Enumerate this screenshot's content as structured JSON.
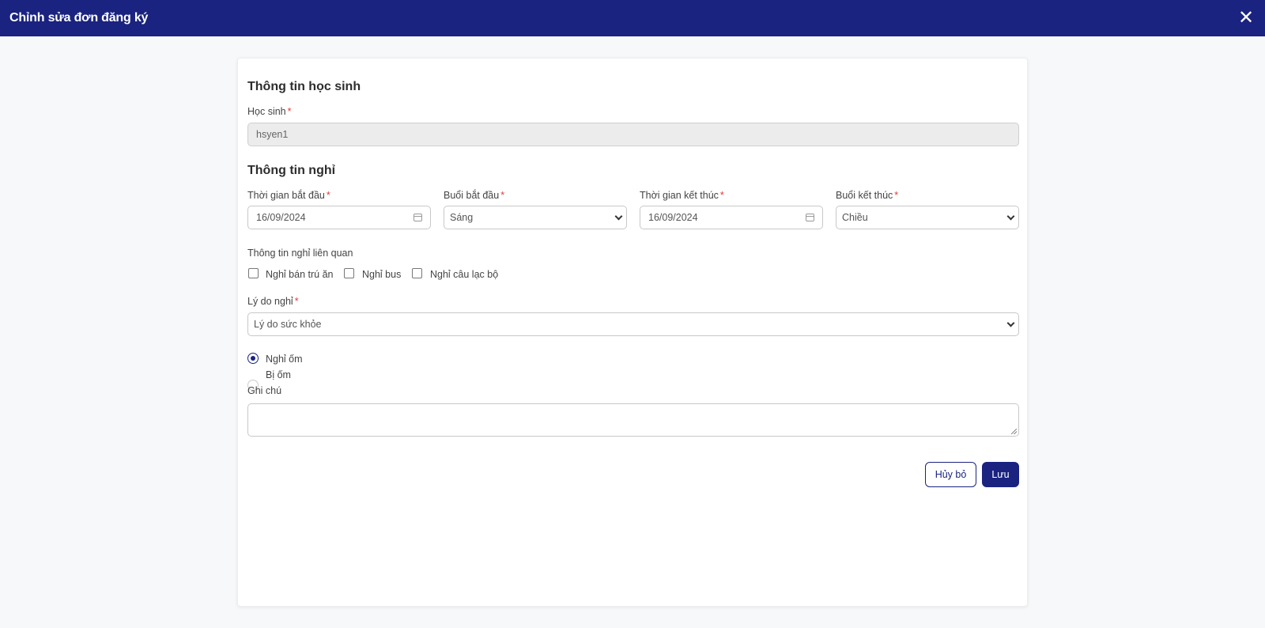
{
  "header": {
    "title": "Chỉnh sửa đơn đăng ký",
    "close_icon": "close-icon"
  },
  "student_section": {
    "heading": "Thông tin học sinh",
    "student_label": "Học sinh",
    "required_mark": "*",
    "student_value": "hsyen1"
  },
  "leave_section": {
    "heading": "Thông tin nghỉ",
    "start_date_label": "Thời gian bắt đầu",
    "start_date_value": "16/09/2024",
    "start_session_label": "Buổi bắt đầu",
    "start_session_value": "Sáng",
    "end_date_label": "Thời gian kết thúc",
    "end_date_value": "16/09/2024",
    "end_session_label": "Buổi kết thúc",
    "end_session_value": "Chiều",
    "related_label": "Thông tin nghỉ liên quan",
    "related_options": [
      {
        "label": "Nghỉ bán trú ăn",
        "checked": false
      },
      {
        "label": "Nghỉ bus",
        "checked": false
      },
      {
        "label": "Nghỉ câu lạc bộ",
        "checked": false
      }
    ],
    "reason_label": "Lý do nghỉ",
    "reason_value": "Lý do sức khỏe",
    "reason_detail_options": [
      {
        "label": "Nghỉ ốm",
        "selected": true
      },
      {
        "label": "Bị ốm",
        "selected": false
      }
    ],
    "note_label": "Ghi chú",
    "note_value": ""
  },
  "actions": {
    "cancel_label": "Hủy bỏ",
    "save_label": "Lưu"
  },
  "colors": {
    "primary": "#1a2380",
    "required": "#e53935"
  }
}
